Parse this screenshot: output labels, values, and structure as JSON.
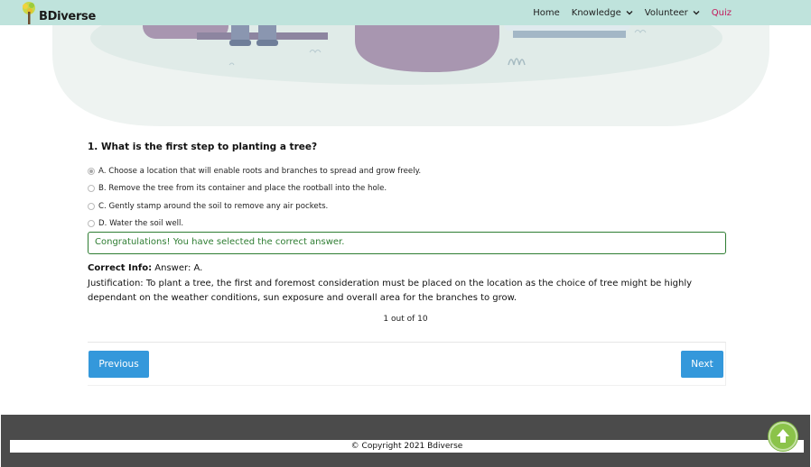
{
  "header": {
    "brand": "BDiverse",
    "nav": [
      {
        "label": "Home",
        "dropdown": false,
        "active": false
      },
      {
        "label": "Knowledge",
        "dropdown": true,
        "active": false
      },
      {
        "label": "Volunteer",
        "dropdown": true,
        "active": false
      },
      {
        "label": "Quiz",
        "dropdown": false,
        "active": true
      }
    ]
  },
  "quiz": {
    "question": "1. What is the first step to planting a tree?",
    "options": [
      {
        "label": "A. Choose a location that will enable roots and branches to spread and grow freely.",
        "selected": true
      },
      {
        "label": "B. Remove the tree from its container and place the rootball into the hole.",
        "selected": false
      },
      {
        "label": "C. Gently stamp around the soil to remove any air pockets.",
        "selected": false
      },
      {
        "label": "D. Water the soil well.",
        "selected": false
      }
    ],
    "result": "Congratulations! You have selected the correct answer.",
    "correct_info_label": "Correct Info:",
    "correct_info_answer": "Answer: A.",
    "justification": "Justification: To plant a tree, the first and foremost consideration must be placed on the location as the choice of tree might be highly dependant on the weather conditions, sun exposure and overall area for the branches to grow.",
    "progress": "1 out of 10",
    "previous_label": "Previous",
    "next_label": "Next"
  },
  "footer": {
    "copyright": "© Copyright 2021 Bdiverse"
  },
  "colors": {
    "header_bg": "#bfe3dc",
    "active_nav": "#c2185b",
    "button": "#3498db",
    "success": "#2e7d32",
    "footer_bg": "#4b4b4b"
  },
  "icons": [
    "tree-logo-icon",
    "chevron-down-icon",
    "arrow-up-icon"
  ]
}
